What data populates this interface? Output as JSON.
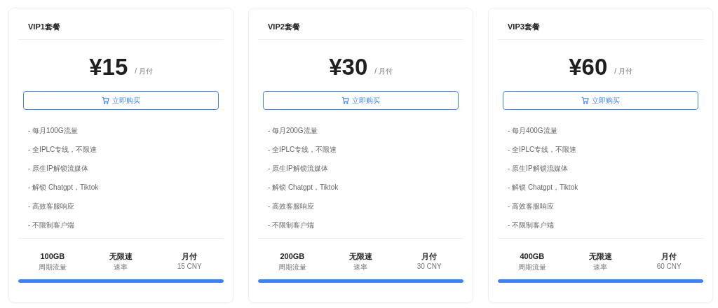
{
  "plans": [
    {
      "title": "VIP1套餐",
      "price": "¥15",
      "period": "/ 月付",
      "buy_label": "立即购买",
      "features": [
        "- 每月100G流量",
        "- 全IPLC专线，不限速",
        "- 原生IP解锁流媒体",
        "- 解锁 Chatgpt，Tiktok",
        "- 高效客服响应",
        "- 不限制客户端"
      ],
      "stats": [
        {
          "value": "100GB",
          "label": "周期流量"
        },
        {
          "value": "无限速",
          "label": "速率"
        },
        {
          "value": "月付",
          "label": "15 CNY"
        }
      ],
      "level": 1
    },
    {
      "title": "VIP2套餐",
      "price": "¥30",
      "period": "/ 月付",
      "buy_label": "立即购买",
      "features": [
        "- 每月200G流量",
        "- 全IPLC专线，不限速",
        "- 原生IP解锁流媒体",
        "- 解锁 Chatgpt，Tiktok",
        "- 高效客服响应",
        "- 不限制客户端"
      ],
      "stats": [
        {
          "value": "200GB",
          "label": "周期流量"
        },
        {
          "value": "无限速",
          "label": "速率"
        },
        {
          "value": "月付",
          "label": "30 CNY"
        }
      ],
      "level": 1
    },
    {
      "title": "VIP3套餐",
      "price": "¥60",
      "period": "/ 月付",
      "buy_label": "立即购买",
      "features": [
        "- 每月400G流量",
        "- 全IPLC专线，不限速",
        "- 原生IP解锁流媒体",
        "- 解锁 Chatgpt，Tiktok",
        "- 高效客服响应",
        "- 不限制客户端"
      ],
      "stats": [
        {
          "value": "400GB",
          "label": "周期流量"
        },
        {
          "value": "无限速",
          "label": "速率"
        },
        {
          "value": "月付",
          "label": "60 CNY"
        }
      ],
      "level": 1
    }
  ]
}
